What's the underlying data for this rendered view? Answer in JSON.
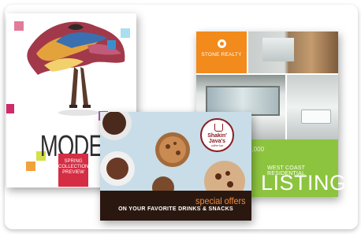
{
  "realty": {
    "logo_text": "STONE REALTY",
    "price_fragment": "0,000",
    "subtitle": "WEST COAST RESIDENTIAL",
    "big_word": "LISTING",
    "colors": {
      "orange": "#f28a1c",
      "green": "#8dc43f"
    }
  },
  "magazine": {
    "title": "MODE",
    "badge_lines": [
      "SPRING",
      "COLLECTION",
      "PREVIEW"
    ],
    "colors": {
      "accent": "#d52d44"
    }
  },
  "coffee": {
    "brand_line1": "Shakin'",
    "brand_line2": "Java's",
    "brand_tagline": "coffee bar",
    "special": "special offers",
    "drinks": "ON YOUR FAVORITE DRINKS & SNACKS",
    "colors": {
      "dark": "#2a1810",
      "orange": "#f08a3c",
      "badge": "#8b1c23"
    }
  }
}
